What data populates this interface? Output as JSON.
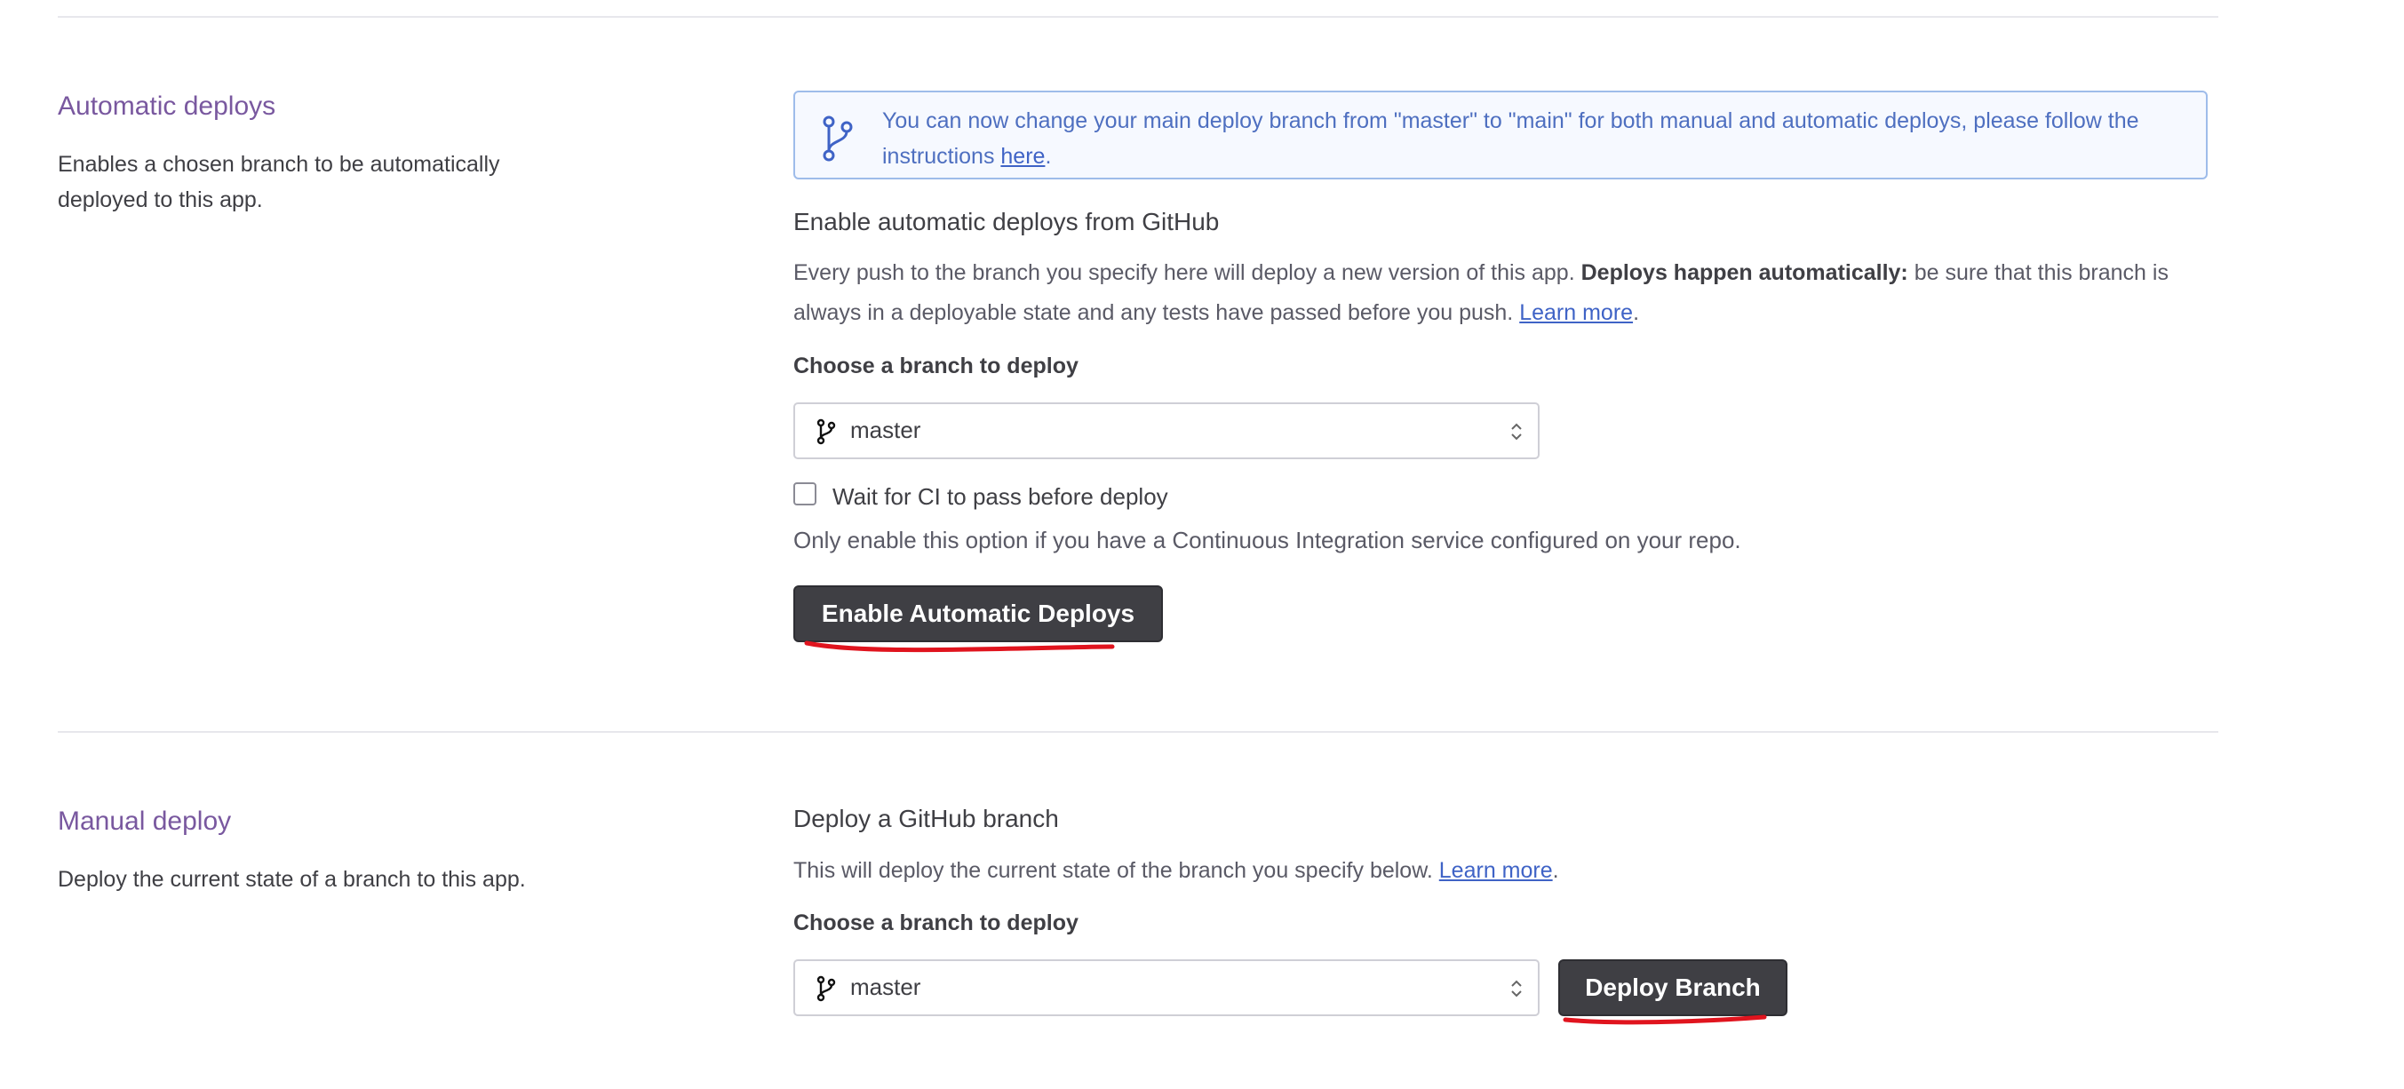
{
  "automatic": {
    "title": "Automatic deploys",
    "description": "Enables a chosen branch to be automatically deployed to this app.",
    "notice": {
      "text": "You can now change your main deploy branch from \"master\" to \"main\" for both manual and automatic deploys, please follow the instructions ",
      "link": "here",
      "end": "."
    },
    "heading": "Enable automatic deploys from GitHub",
    "para_start": "Every push to the branch you specify here will deploy a new version of this app. ",
    "para_bold": "Deploys happen automatically:",
    "para_rest": " be sure that this branch is always in a deployable state and any tests have passed before you push. ",
    "learn_more": "Learn more",
    "para_end": ".",
    "choose_label": "Choose a branch to deploy",
    "branch": "master",
    "ci_label": "Wait for CI to pass before deploy",
    "ci_hint": "Only enable this option if you have a Continuous Integration service configured on your repo.",
    "button": "Enable Automatic Deploys"
  },
  "manual": {
    "title": "Manual deploy",
    "description": "Deploy the current state of a branch to this app.",
    "heading": "Deploy a GitHub branch",
    "para": "This will deploy the current state of the branch you specify below. ",
    "learn_more": "Learn more",
    "para_end": ".",
    "choose_label": "Choose a branch to deploy",
    "branch": "master",
    "button": "Deploy Branch"
  },
  "colors": {
    "accent_purple": "#79589f",
    "link_blue": "#3f63c6",
    "button_dark": "#3f3f44",
    "annotation_red": "#e0141e"
  }
}
